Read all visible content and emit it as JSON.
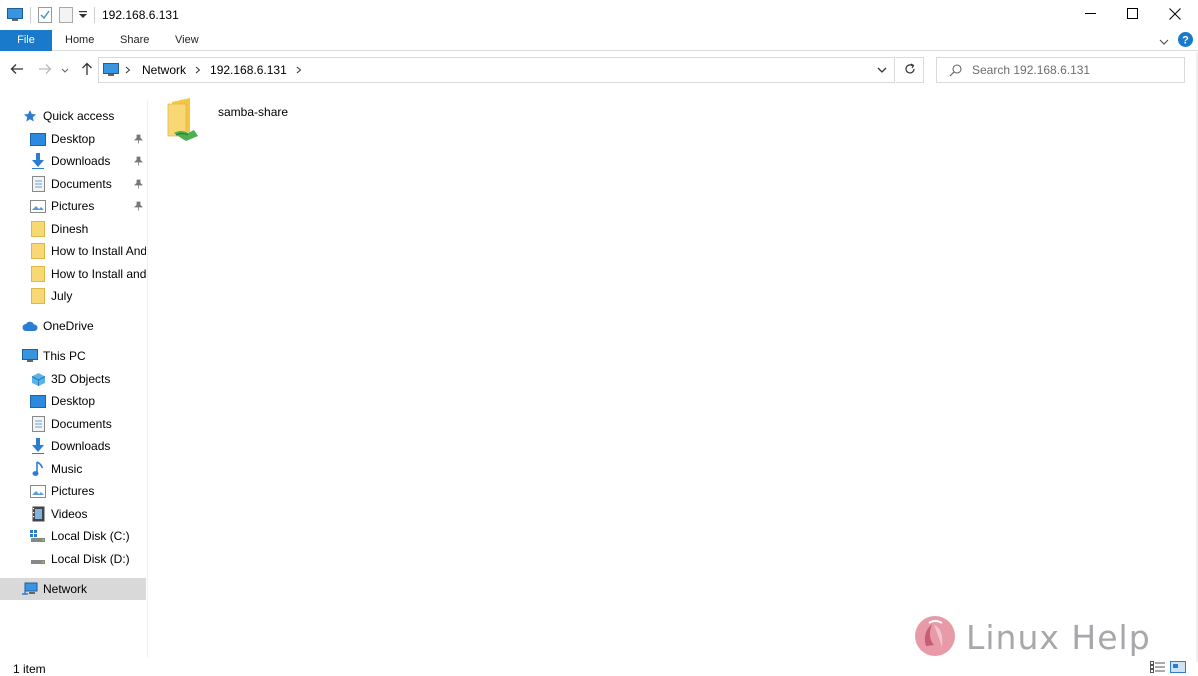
{
  "window": {
    "title": "192.168.6.131",
    "minimize": "minimize-icon",
    "maximize": "maximize-icon",
    "close": "close-icon"
  },
  "ribbon": {
    "tabs": [
      {
        "label": "File"
      },
      {
        "label": "Home"
      },
      {
        "label": "Share"
      },
      {
        "label": "View"
      }
    ]
  },
  "address": {
    "crumbs": [
      {
        "label": "Network"
      },
      {
        "label": "192.168.6.131"
      }
    ]
  },
  "search": {
    "placeholder": "Search 192.168.6.131"
  },
  "sidebar": {
    "quick_access": {
      "label": "Quick access",
      "items": [
        {
          "label": "Desktop",
          "icon": "desktop-icon",
          "pinned": true
        },
        {
          "label": "Downloads",
          "icon": "downloads-icon",
          "pinned": true
        },
        {
          "label": "Documents",
          "icon": "documents-icon",
          "pinned": true
        },
        {
          "label": "Pictures",
          "icon": "pictures-icon",
          "pinned": true
        },
        {
          "label": "Dinesh",
          "icon": "folder-icon",
          "pinned": false
        },
        {
          "label": "How to Install And C",
          "icon": "folder-icon",
          "pinned": false
        },
        {
          "label": "How to Install and C",
          "icon": "folder-icon",
          "pinned": false
        },
        {
          "label": "July",
          "icon": "folder-icon",
          "pinned": false
        }
      ]
    },
    "onedrive": {
      "label": "OneDrive"
    },
    "this_pc": {
      "label": "This PC",
      "items": [
        {
          "label": "3D Objects",
          "icon": "3d-objects-icon"
        },
        {
          "label": "Desktop",
          "icon": "desktop-icon"
        },
        {
          "label": "Documents",
          "icon": "documents-icon"
        },
        {
          "label": "Downloads",
          "icon": "downloads-icon"
        },
        {
          "label": "Music",
          "icon": "music-icon"
        },
        {
          "label": "Pictures",
          "icon": "pictures-icon"
        },
        {
          "label": "Videos",
          "icon": "videos-icon"
        },
        {
          "label": "Local Disk (C:)",
          "icon": "local-disk-c-icon"
        },
        {
          "label": "Local Disk (D:)",
          "icon": "local-disk-d-icon"
        }
      ]
    },
    "network": {
      "label": "Network"
    }
  },
  "content": {
    "items": [
      {
        "label": "samba-share",
        "icon": "shared-folder-icon"
      }
    ]
  },
  "status": {
    "item_count": "1 item"
  },
  "watermark": {
    "text": "Linux Help"
  },
  "colors": {
    "file_tab": "#1979ca",
    "selected_nav": "#d9d9d9",
    "folder": "#f8d775",
    "help": "#1979ca"
  }
}
